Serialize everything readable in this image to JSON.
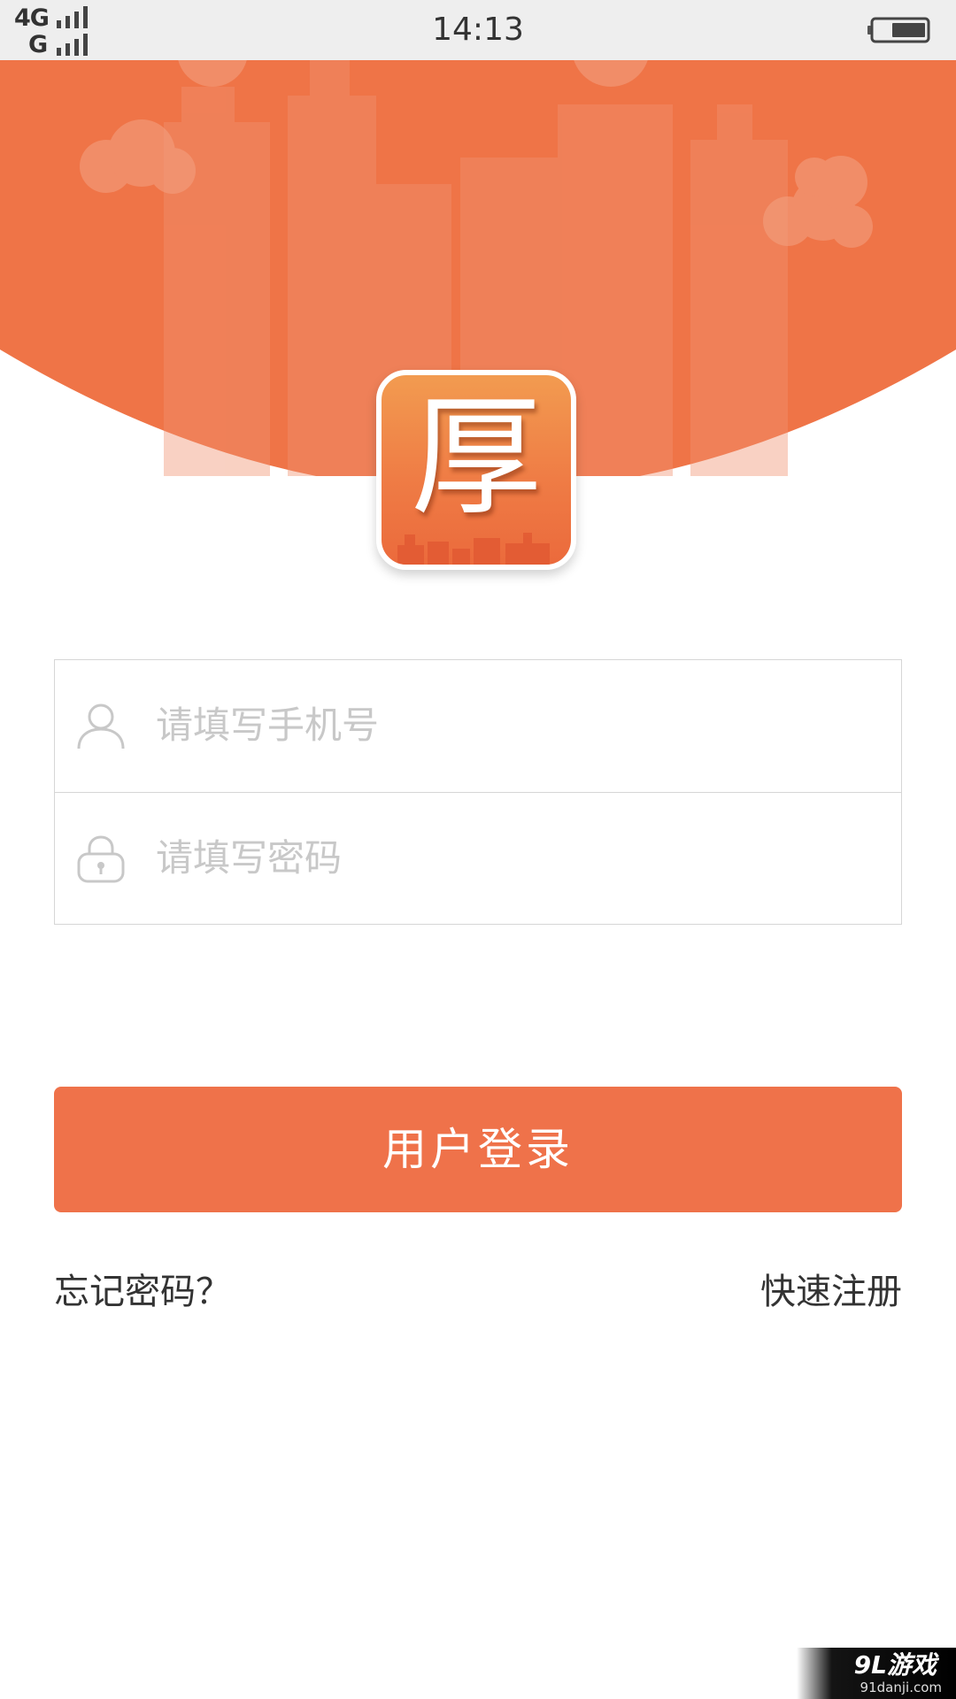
{
  "status_bar": {
    "network_primary": "4G",
    "network_secondary": "G",
    "time": "14:13",
    "battery_icon": "battery-icon",
    "signal_icon": "signal-bars-icon"
  },
  "app": {
    "logo_char": "厚",
    "brand_color": "#ef724a"
  },
  "login": {
    "phone_placeholder": "请填写手机号",
    "phone_icon": "user-icon",
    "password_placeholder": "请填写密码",
    "password_icon": "lock-icon",
    "submit_label": "用户登录",
    "forgot_label": "忘记密码？",
    "register_label": "快速注册"
  },
  "watermark": {
    "logo": "9L游戏",
    "url": "91danji.com"
  }
}
